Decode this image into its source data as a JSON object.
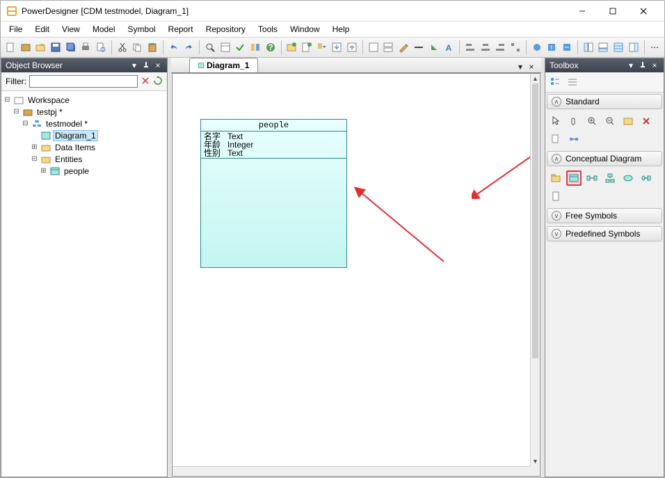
{
  "titlebar": {
    "title": "PowerDesigner [CDM testmodel, Diagram_1]"
  },
  "menu": [
    "File",
    "Edit",
    "View",
    "Model",
    "Symbol",
    "Report",
    "Repository",
    "Tools",
    "Window",
    "Help"
  ],
  "browser": {
    "title": "Object Browser",
    "filter_label": "Filter:",
    "filter_value": "",
    "tree": {
      "workspace": "Workspace",
      "project": "testpj *",
      "model": "testmodel *",
      "diagram": "Diagram_1",
      "dataitems": "Data Items",
      "entities": "Entities",
      "entity0": "people"
    }
  },
  "doctab": {
    "label": "Diagram_1"
  },
  "entity": {
    "name": "people",
    "attrs": [
      {
        "n": "名字",
        "t": "Text"
      },
      {
        "n": "年龄",
        "t": "Integer"
      },
      {
        "n": "性别",
        "t": "Text"
      }
    ]
  },
  "toolbox": {
    "title": "Toolbox",
    "sections": {
      "standard": "Standard",
      "conceptual": "Conceptual Diagram",
      "free": "Free Symbols",
      "predefined": "Predefined Symbols"
    }
  }
}
